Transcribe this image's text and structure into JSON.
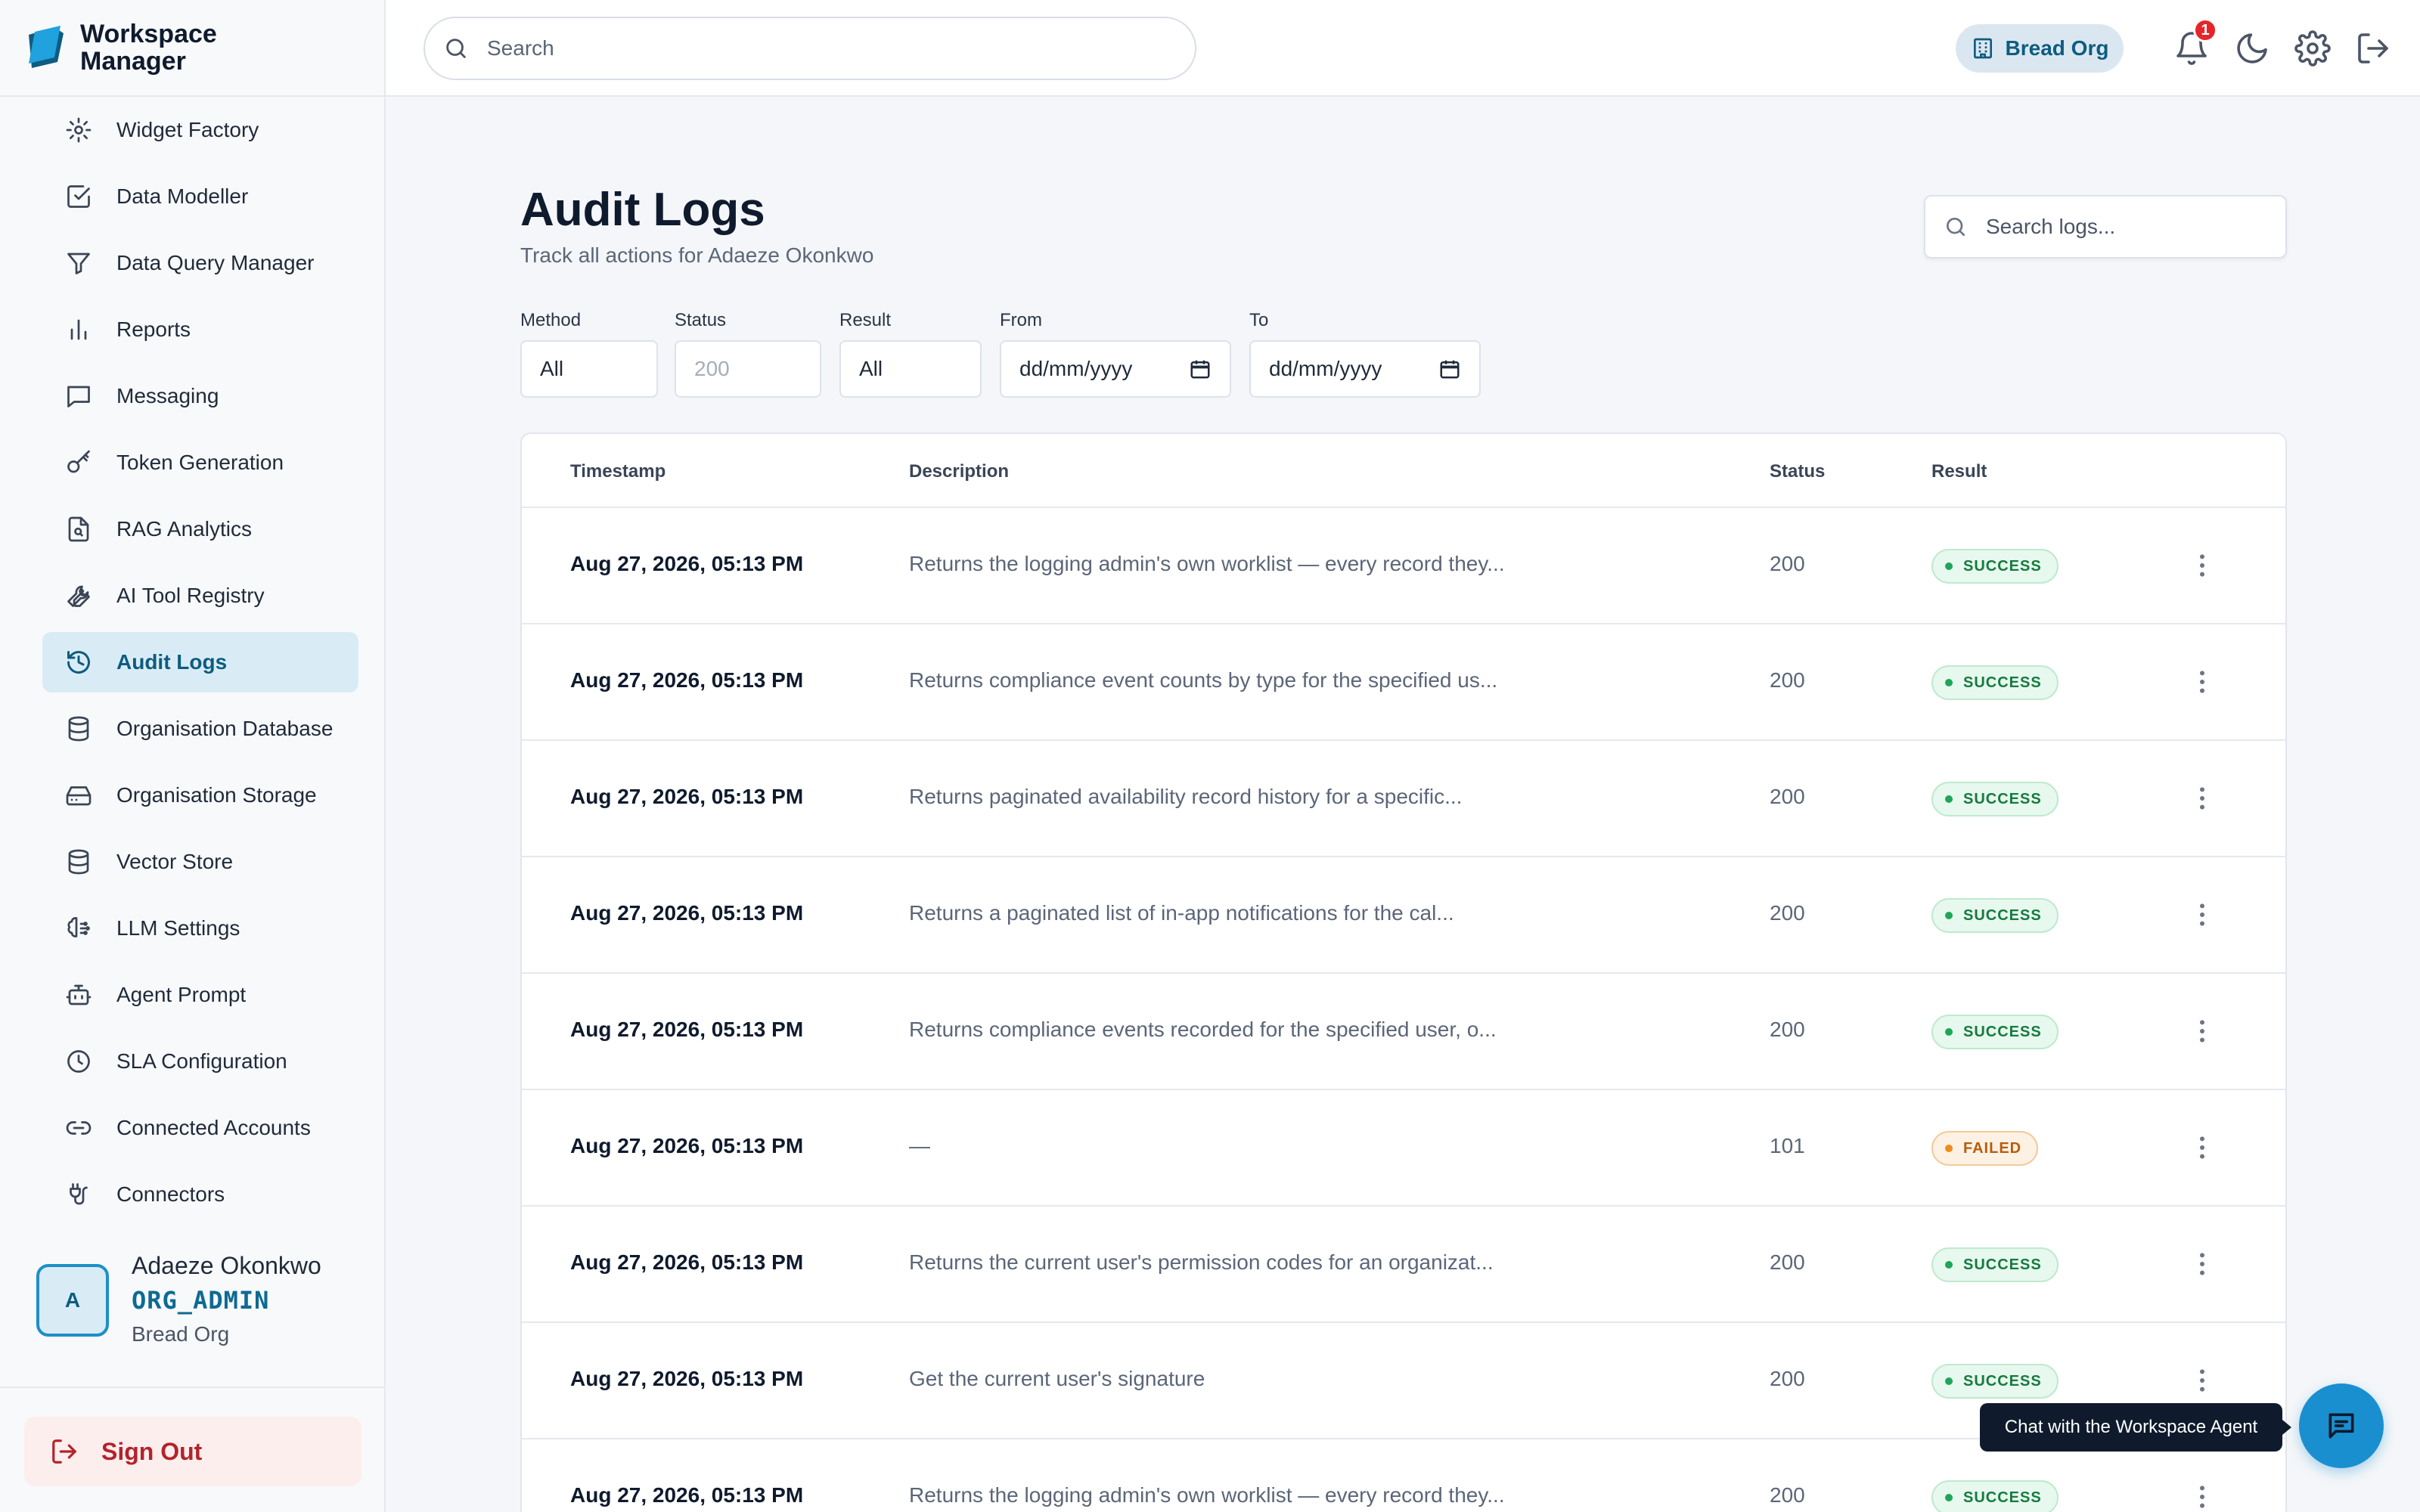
{
  "brand": {
    "name": "Workspace Manager",
    "logo_icon": "workspace-logo-icon",
    "accent": "#1d8fc8"
  },
  "sidebar": {
    "items": [
      {
        "label": "Widget Factory",
        "icon": "gear-icon",
        "active": false
      },
      {
        "label": "Data Modeller",
        "icon": "checkbox-icon",
        "active": false
      },
      {
        "label": "Data Query Manager",
        "icon": "filter-icon",
        "active": false
      },
      {
        "label": "Reports",
        "icon": "bar-chart-icon",
        "active": false
      },
      {
        "label": "Messaging",
        "icon": "message-icon",
        "active": false
      },
      {
        "label": "Token Generation",
        "icon": "key-icon",
        "active": false
      },
      {
        "label": "RAG Analytics",
        "icon": "document-search-icon",
        "active": false
      },
      {
        "label": "AI Tool Registry",
        "icon": "wrench-icon",
        "active": false
      },
      {
        "label": "Audit Logs",
        "icon": "history-icon",
        "active": true
      },
      {
        "label": "Organisation Database",
        "icon": "database-icon",
        "active": false
      },
      {
        "label": "Organisation Storage",
        "icon": "hard-drive-icon",
        "active": false
      },
      {
        "label": "Vector Store",
        "icon": "database-icon",
        "active": false
      },
      {
        "label": "LLM Settings",
        "icon": "brain-icon",
        "active": false
      },
      {
        "label": "Agent Prompt",
        "icon": "bot-icon",
        "active": false
      },
      {
        "label": "SLA Configuration",
        "icon": "clock-icon",
        "active": false
      },
      {
        "label": "Connected Accounts",
        "icon": "link-icon",
        "active": false
      },
      {
        "label": "Connectors",
        "icon": "plug-icon",
        "active": false
      }
    ],
    "user": {
      "initial": "A",
      "name": "Adaeze Okonkwo",
      "role": "ORG_ADMIN",
      "org": "Bread Org"
    },
    "signout_label": "Sign Out"
  },
  "topbar": {
    "search_placeholder": "Search",
    "org_label": "Bread Org",
    "notification_count": "1"
  },
  "main": {
    "title": "Audit Logs",
    "subtitle": "Track all actions for Adaeze Okonkwo",
    "search_placeholder": "Search logs...",
    "filters": {
      "method": {
        "label": "Method",
        "value": "All"
      },
      "status": {
        "label": "Status",
        "placeholder": "200"
      },
      "result": {
        "label": "Result",
        "value": "All"
      },
      "from": {
        "label": "From",
        "value": "dd/mm/yyyy"
      },
      "to": {
        "label": "To",
        "value": "dd/mm/yyyy"
      }
    },
    "columns": [
      "Timestamp",
      "Description",
      "Status",
      "Result"
    ],
    "rows": [
      {
        "timestamp": "Aug 27, 2026, 05:13 PM",
        "description": "Returns the logging admin's own worklist — every record they...",
        "status": "200",
        "result": "SUCCESS"
      },
      {
        "timestamp": "Aug 27, 2026, 05:13 PM",
        "description": "Returns compliance event counts by type for the specified us...",
        "status": "200",
        "result": "SUCCESS"
      },
      {
        "timestamp": "Aug 27, 2026, 05:13 PM",
        "description": "Returns paginated availability record history for a specific...",
        "status": "200",
        "result": "SUCCESS"
      },
      {
        "timestamp": "Aug 27, 2026, 05:13 PM",
        "description": "Returns a paginated list of in-app notifications for the cal...",
        "status": "200",
        "result": "SUCCESS"
      },
      {
        "timestamp": "Aug 27, 2026, 05:13 PM",
        "description": "Returns compliance events recorded for the specified user, o...",
        "status": "200",
        "result": "SUCCESS"
      },
      {
        "timestamp": "Aug 27, 2026, 05:13 PM",
        "description": "—",
        "status": "101",
        "result": "FAILED"
      },
      {
        "timestamp": "Aug 27, 2026, 05:13 PM",
        "description": "Returns the current user's permission codes for an organizat...",
        "status": "200",
        "result": "SUCCESS"
      },
      {
        "timestamp": "Aug 27, 2026, 05:13 PM",
        "description": "Get the current user's signature",
        "status": "200",
        "result": "SUCCESS"
      },
      {
        "timestamp": "Aug 27, 2026, 05:13 PM",
        "description": "Returns the logging admin's own worklist — every record they...",
        "status": "200",
        "result": "SUCCESS"
      }
    ],
    "colors": {
      "success": "#1fa559",
      "failed": "#f08a1c"
    }
  },
  "chat": {
    "tooltip": "Chat with the Workspace Agent",
    "icon": "chat-icon"
  }
}
